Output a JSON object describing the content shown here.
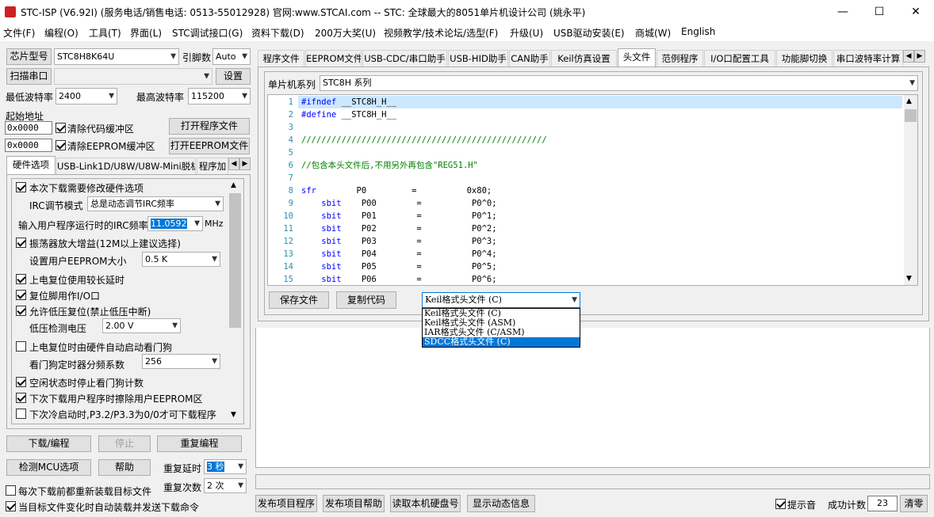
{
  "window": {
    "title": "STC-ISP (V6.92I) (服务电话/销售电话: 0513-55012928) 官网:www.STCAI.com  -- STC: 全球最大的8051单片机设计公司 (姚永平)",
    "minimize": "—",
    "maximize": "☐",
    "close": "✕"
  },
  "menu": [
    "文件(F)",
    "编程(O)",
    "工具(T)",
    "界面(L)",
    "STC调试接口(G)",
    "资料下载(D)",
    "200万大奖(U)",
    "视频教学/技术论坛/选型(F)",
    "升级(U)",
    "USB驱动安装(E)",
    "商城(W)",
    "English"
  ],
  "left": {
    "chip_type_btn": "芯片型号",
    "chip_type_value": "STC8H8K64U",
    "pin_count_label": "引脚数",
    "pin_count_value": "Auto",
    "scan_port_btn": "扫描串口",
    "port_value": "",
    "settings_btn": "设置",
    "min_baud_label": "最低波特率",
    "min_baud_value": "2400",
    "max_baud_label": "最高波特率",
    "max_baud_value": "115200",
    "start_addr_label": "起始地址",
    "addr1": "0x0000",
    "clear_code_label": "清除代码缓冲区",
    "open_program_btn": "打开程序文件",
    "addr2": "0x0000",
    "clear_eeprom_label": "清除EEPROM缓冲区",
    "open_eeprom_btn": "打开EEPROM文件",
    "tabs": [
      "硬件选项",
      "USB-Link1D/U8W/U8W-Mini脱机",
      "程序加"
    ],
    "options": {
      "opt1": "本次下载需要修改硬件选项",
      "irc_mode_label": "IRC调节模式",
      "irc_mode_value": "总是动态调节IRC频率",
      "irc_freq_label": "输入用户程序运行时的IRC频率",
      "irc_freq_value": "11.0592",
      "irc_freq_unit": "MHz",
      "opt2": "振荡器放大增益(12M以上建议选择)",
      "eeprom_size_label": "设置用户EEPROM大小",
      "eeprom_size_value": "0.5 K",
      "opt3": "上电复位使用较长延时",
      "opt4": "复位脚用作I/O口",
      "opt5": "允许低压复位(禁止低压中断)",
      "low_volt_label": "低压检测电压",
      "low_volt_value": "2.00 V",
      "opt6": "上电复位时由硬件自动启动看门狗",
      "wdt_label": "看门狗定时器分频系数",
      "wdt_value": "256",
      "opt7": "空闲状态时停止看门狗计数",
      "opt8": "下次下载用户程序时擦除用户EEPROM区",
      "opt9": "下次冷启动时,P3.2/P3.3为0/0才可下载程序"
    },
    "download_btn": "下载/编程",
    "stop_btn": "停止",
    "reprogram_btn": "重复编程",
    "detect_btn": "检测MCU选项",
    "help_btn": "帮助",
    "repeat_delay_label": "重复延时",
    "repeat_delay_value": "3 秒",
    "repeat_count_label": "重复次数",
    "repeat_count_value": "2 次",
    "reload_label": "每次下载前都重新装载目标文件",
    "auto_reload_label": "当目标文件变化时自动装载并发送下载命令"
  },
  "right": {
    "tabs": [
      "程序文件",
      "EEPROM文件",
      "USB-CDC/串口助手",
      "USB-HID助手",
      "CAN助手",
      "Keil仿真设置",
      "头文件",
      "范例程序",
      "I/O口配置工具",
      "功能脚切换",
      "串口波特率计算"
    ],
    "series_label": "单片机系列",
    "series_value": "STC8H 系列",
    "code_lines": [
      {
        "n": "1",
        "a": "#ifndef",
        "b": " __STC8H_H__",
        "t": "kw"
      },
      {
        "n": "2",
        "a": "#define",
        "b": " __STC8H_H__",
        "t": "kw"
      },
      {
        "n": "3",
        "a": "",
        "b": "",
        "t": "id"
      },
      {
        "n": "4",
        "a": "/////////////////////////////////////////////////",
        "b": "",
        "t": "cm"
      },
      {
        "n": "5",
        "a": "",
        "b": "",
        "t": "id"
      },
      {
        "n": "6",
        "a": "//包含本头文件后,不用另外再包含\"REG51.H\"",
        "b": "",
        "t": "cm"
      },
      {
        "n": "7",
        "a": "",
        "b": "",
        "t": "id"
      },
      {
        "n": "8",
        "a": "sfr",
        "b": "        P0         =          0x80;",
        "t": "kw"
      },
      {
        "n": "9",
        "a": "    sbit",
        "b": "    P00        =          P0^0;",
        "t": "kw"
      },
      {
        "n": "10",
        "a": "    sbit",
        "b": "    P01        =          P0^1;",
        "t": "kw"
      },
      {
        "n": "11",
        "a": "    sbit",
        "b": "    P02        =          P0^2;",
        "t": "kw"
      },
      {
        "n": "12",
        "a": "    sbit",
        "b": "    P03        =          P0^3;",
        "t": "kw"
      },
      {
        "n": "13",
        "a": "    sbit",
        "b": "    P04        =          P0^4;",
        "t": "kw"
      },
      {
        "n": "14",
        "a": "    sbit",
        "b": "    P05        =          P0^5;",
        "t": "kw"
      },
      {
        "n": "15",
        "a": "    sbit",
        "b": "    P06        =          P0^6;",
        "t": "kw"
      }
    ],
    "save_file_btn": "保存文件",
    "copy_code_btn": "复制代码",
    "format_value": "Keil格式头文件 (C)",
    "format_options": [
      "Keil格式头文件 (C)",
      "Keil格式头文件 (ASM)",
      "IAR格式头文件 (C/ASM)",
      "SDCC格式头文件 (C)"
    ],
    "publish_program_btn": "发布项目程序",
    "publish_help_btn": "发布项目帮助",
    "read_disk_btn": "读取本机硬盘号",
    "show_dynamic_btn": "显示动态信息",
    "prompt_sound_label": "提示音",
    "success_count_label": "成功计数",
    "success_count_value": "23",
    "clear_btn": "清零"
  }
}
